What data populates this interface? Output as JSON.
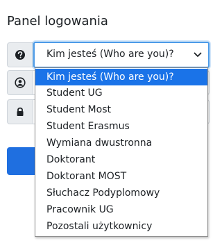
{
  "panel": {
    "title": "Panel logowania"
  },
  "user_type": {
    "selected_label": "Kim jesteś (Who are you)?",
    "options": [
      "Kim jesteś (Who are you)?",
      "Student UG",
      "Student Most",
      "Student Erasmus",
      "Wymiana dwustronna",
      "Doktorant",
      "Doktorant MOST",
      "Słuchacz Podyplomowy",
      "Pracownik UG",
      "Pozostali użytkownicy"
    ]
  },
  "icons": {
    "row1": "question-circle-icon",
    "row2": "user-icon",
    "row3": "lock-icon"
  },
  "colors": {
    "focus_border": "#4c9be8",
    "selected_option_bg": "#1a73e8",
    "login_button": "#1f6fe0"
  }
}
